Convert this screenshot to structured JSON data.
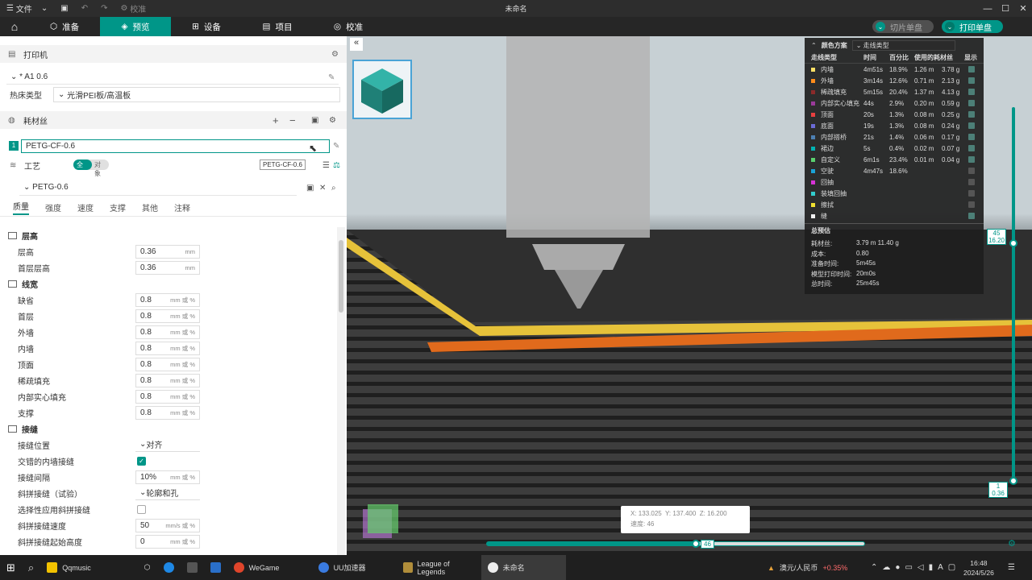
{
  "titlebar": {
    "file": "文件",
    "settings": "校准",
    "title": "未命名"
  },
  "nav": {
    "tabs": [
      "准备",
      "预览",
      "设备",
      "项目",
      "校准"
    ],
    "slice_btn": "切片单盘",
    "print_btn": "打印单盘"
  },
  "printer": {
    "header": "打印机",
    "name": "* A1 0.6",
    "bed_label": "热床类型",
    "bed_value": "光滑PEI板/高温板"
  },
  "filament": {
    "header": "耗材丝",
    "index": "1",
    "name": "PETG-CF-0.6",
    "tooltip": "PETG-CF-0.6"
  },
  "process": {
    "header": "工艺",
    "toggle_global": "全局",
    "toggle_object": "对象",
    "preset": "PETG-0.6",
    "tabs": [
      "质量",
      "强度",
      "速度",
      "支撑",
      "其他",
      "注释"
    ]
  },
  "params": {
    "layer_group": "层高",
    "layer": [
      {
        "label": "层高",
        "value": "0.36",
        "unit": "mm"
      },
      {
        "label": "首层层高",
        "value": "0.36",
        "unit": "mm"
      }
    ],
    "width_group": "线宽",
    "width": [
      {
        "label": "缺省",
        "value": "0.8",
        "unit": "mm 或 %"
      },
      {
        "label": "首层",
        "value": "0.8",
        "unit": "mm 或 %"
      },
      {
        "label": "外墙",
        "value": "0.8",
        "unit": "mm 或 %"
      },
      {
        "label": "内墙",
        "value": "0.8",
        "unit": "mm 或 %"
      },
      {
        "label": "顶面",
        "value": "0.8",
        "unit": "mm 或 %"
      },
      {
        "label": "稀疏填充",
        "value": "0.8",
        "unit": "mm 或 %"
      },
      {
        "label": "内部实心填充",
        "value": "0.8",
        "unit": "mm 或 %"
      },
      {
        "label": "支撑",
        "value": "0.8",
        "unit": "mm 或 %"
      }
    ],
    "seam_group": "接缝",
    "seam_pos_label": "接缝位置",
    "seam_pos_value": "对齐",
    "staggered_label": "交错的内墙接缝",
    "seam_gap_label": "接缝间隔",
    "seam_gap_value": "10%",
    "seam_gap_unit": "mm 或 %",
    "scarf_label": "斜拼接缝（试验）",
    "scarf_value": "轮廓和孔",
    "scarf_sel_label": "选择性应用斜拼接缝",
    "scarf_speed_label": "斜拼接缝速度",
    "scarf_speed_value": "50",
    "scarf_speed_unit": "mm/s 或 %",
    "scarf_start_label": "斜拼接缝起始高度",
    "scarf_start_value": "0",
    "scarf_start_unit": "mm 或 %"
  },
  "legend": {
    "title": "颜色方案",
    "scheme": "走线类型",
    "cols": [
      "走线类型",
      "时间",
      "百分比",
      "使用的耗材丝",
      "显示"
    ],
    "rows": [
      {
        "name": "内墙",
        "color": "#ffe066",
        "time": "4m51s",
        "pct": "18.9%",
        "len": "1.26 m",
        "wt": "3.78 g",
        "on": true
      },
      {
        "name": "外墙",
        "color": "#ff8c1a",
        "time": "3m14s",
        "pct": "12.6%",
        "len": "0.71 m",
        "wt": "2.13 g",
        "on": true
      },
      {
        "name": "稀疏填充",
        "color": "#8b2a2a",
        "time": "5m15s",
        "pct": "20.4%",
        "len": "1.37 m",
        "wt": "4.13 g",
        "on": true
      },
      {
        "name": "内部实心填充",
        "color": "#9a3a9a",
        "time": "44s",
        "pct": "2.9%",
        "len": "0.20 m",
        "wt": "0.59 g",
        "on": true
      },
      {
        "name": "顶面",
        "color": "#e84040",
        "time": "20s",
        "pct": "1.3%",
        "len": "0.08 m",
        "wt": "0.25 g",
        "on": true
      },
      {
        "name": "底面",
        "color": "#6b6bd6",
        "time": "19s",
        "pct": "1.3%",
        "len": "0.08 m",
        "wt": "0.24 g",
        "on": true
      },
      {
        "name": "内部搭桥",
        "color": "#4d80b3",
        "time": "21s",
        "pct": "1.4%",
        "len": "0.06 m",
        "wt": "0.17 g",
        "on": true
      },
      {
        "name": "裙边",
        "color": "#00b3b3",
        "time": "5s",
        "pct": "0.4%",
        "len": "0.02 m",
        "wt": "0.07 g",
        "on": true
      },
      {
        "name": "自定义",
        "color": "#5ad06e",
        "time": "6m1s",
        "pct": "23.4%",
        "len": "0.01 m",
        "wt": "0.04 g",
        "on": true
      },
      {
        "name": "空驶",
        "color": "#1aa3d6",
        "time": "4m47s",
        "pct": "18.6%",
        "len": "",
        "wt": "",
        "on": false
      },
      {
        "name": "回抽",
        "color": "#d633d6",
        "time": "",
        "pct": "",
        "len": "",
        "wt": "",
        "on": false
      },
      {
        "name": "装填回抽",
        "color": "#33cccc",
        "time": "",
        "pct": "",
        "len": "",
        "wt": "",
        "on": false
      },
      {
        "name": "擦拭",
        "color": "#f0e030",
        "time": "",
        "pct": "",
        "len": "",
        "wt": "",
        "on": false
      },
      {
        "name": "缝",
        "color": "#f0f0f0",
        "time": "",
        "pct": "",
        "len": "",
        "wt": "",
        "on": true
      }
    ],
    "summary_title": "总预估",
    "summary": [
      {
        "k": "耗材丝:",
        "v": "3.79 m     11.40 g"
      },
      {
        "k": "成本:",
        "v": "0.80"
      },
      {
        "k": "准备时间:",
        "v": "5m45s"
      },
      {
        "k": "模型打印时间:",
        "v": "20m0s"
      },
      {
        "k": "总时间:",
        "v": "25m45s"
      }
    ]
  },
  "slider": {
    "top_layer": "45",
    "top_height": "16.20",
    "bottom_layer": "1",
    "bottom_height": "0.36",
    "h_value": "46"
  },
  "coords": {
    "x_label": "X:",
    "x": "133.025",
    "y_label": "Y:",
    "y": "137.400",
    "z_label": "Z:",
    "z": "16.200",
    "speed_label": "速度:",
    "speed": "46"
  },
  "taskbar": {
    "apps": [
      "Qqmusic",
      "WeGame",
      "UU加速器",
      "League of Legends",
      "未命名"
    ],
    "currency": "澳元/人民币",
    "change": "+0.35%",
    "time": "16:48",
    "date": "2024/5/26"
  }
}
